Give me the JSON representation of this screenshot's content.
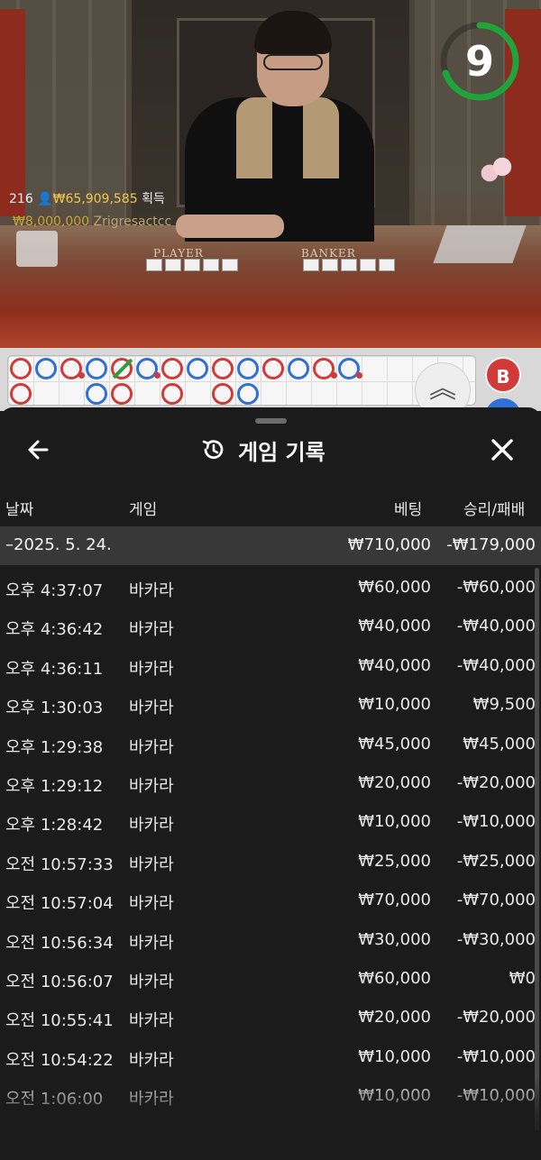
{
  "video": {
    "timer_value": "9",
    "timer_color": "#1fa33a",
    "winner": {
      "count": "216",
      "amount": "₩65,909,585",
      "suffix": "획득",
      "bet_amount": "₩8,000,000",
      "player_name": "Zrigresactcc"
    },
    "table_labels": {
      "player": "PLAYER",
      "banker": "BANKER"
    }
  },
  "roadmap": {
    "expand_icon": "chevron-up-double-icon",
    "banker_label": "B"
  },
  "history": {
    "title": "게임 기록",
    "title_icon": "history-icon",
    "back_icon": "arrow-left-icon",
    "close_icon": "close-icon",
    "columns": {
      "date": "날짜",
      "game": "게임",
      "bet": "베팅",
      "result": "승리/패배"
    },
    "date_group": {
      "date": "–2025. 5. 24.",
      "bet_total": "₩710,000",
      "result_total": "-₩179,000"
    },
    "rows": [
      {
        "time": "오후 4:37:07",
        "game": "바카라",
        "bet": "₩60,000",
        "result": "-₩60,000"
      },
      {
        "time": "오후 4:36:42",
        "game": "바카라",
        "bet": "₩40,000",
        "result": "-₩40,000"
      },
      {
        "time": "오후 4:36:11",
        "game": "바카라",
        "bet": "₩40,000",
        "result": "-₩40,000"
      },
      {
        "time": "오후 1:30:03",
        "game": "바카라",
        "bet": "₩10,000",
        "result": "₩9,500"
      },
      {
        "time": "오후 1:29:38",
        "game": "바카라",
        "bet": "₩45,000",
        "result": "₩45,000"
      },
      {
        "time": "오후 1:29:12",
        "game": "바카라",
        "bet": "₩20,000",
        "result": "-₩20,000"
      },
      {
        "time": "오후 1:28:42",
        "game": "바카라",
        "bet": "₩10,000",
        "result": "-₩10,000"
      },
      {
        "time": "오전 10:57:33",
        "game": "바카라",
        "bet": "₩25,000",
        "result": "-₩25,000"
      },
      {
        "time": "오전 10:57:04",
        "game": "바카라",
        "bet": "₩70,000",
        "result": "-₩70,000"
      },
      {
        "time": "오전 10:56:34",
        "game": "바카라",
        "bet": "₩30,000",
        "result": "-₩30,000"
      },
      {
        "time": "오전 10:56:07",
        "game": "바카라",
        "bet": "₩60,000",
        "result": "₩0"
      },
      {
        "time": "오전 10:55:41",
        "game": "바카라",
        "bet": "₩20,000",
        "result": "-₩20,000"
      },
      {
        "time": "오전 10:54:22",
        "game": "바카라",
        "bet": "₩10,000",
        "result": "-₩10,000"
      },
      {
        "time": "오전 1:06:00",
        "game": "바카라",
        "bet": "₩10,000",
        "result": "-₩10,000"
      }
    ]
  }
}
